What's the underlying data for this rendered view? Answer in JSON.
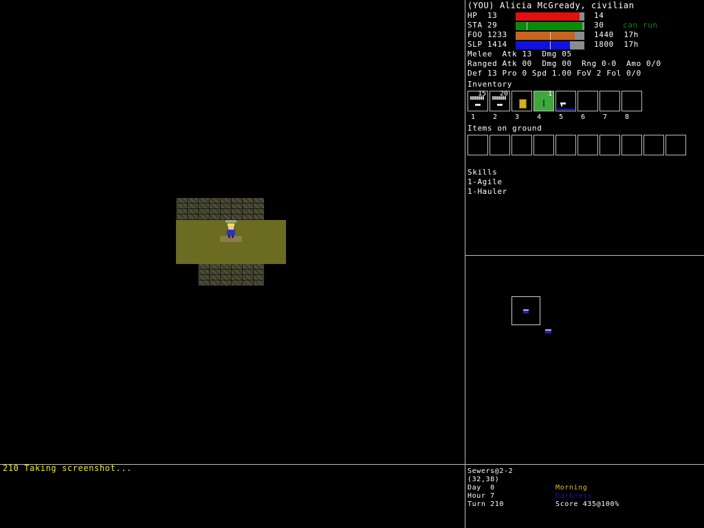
{
  "character": {
    "title": "(YOU) Alicia McGready, civilian"
  },
  "stats": [
    {
      "label": "HP",
      "value": "13",
      "max": "14",
      "extra": "",
      "color": "#e01010",
      "fill": 0.93
    },
    {
      "label": "STA",
      "value": "29",
      "max": "30",
      "extra": "can run",
      "color": "#0a8a0a",
      "fill": 0.97
    },
    {
      "label": "FOO",
      "value": "1233",
      "max": "1440",
      "extra": "17h",
      "color": "#c8641e",
      "fill": 0.86
    },
    {
      "label": "SLP",
      "value": "1414",
      "max": "1800",
      "extra": "17h",
      "color": "#1010e0",
      "fill": 0.79
    }
  ],
  "stat_rows": {
    "hp": "HP  13",
    "sta": "STA 29",
    "foo": "FOO 1233",
    "slp": "SLP 1414",
    "hp_max": "14",
    "sta_max": "30",
    "foo_max": "1440  17h",
    "slp_max": "1800  17h",
    "sta_extra": "can run"
  },
  "combat": {
    "melee": "Melee  Atk 13  Dmg 05",
    "ranged": "Ranged Atk 00  Dmg 00  Rng 0-0  Amo 0/0",
    "defense": "Def 13 Pro 0 Spd 1.00 FoV 2 Fol 0/0"
  },
  "inventory": {
    "heading": "Inventory",
    "slots": [
      {
        "number": "1",
        "qty": "15",
        "item": "ammo-clip"
      },
      {
        "number": "2",
        "qty": "20",
        "item": "ammo-clip"
      },
      {
        "number": "3",
        "qty": "",
        "item": "food-can"
      },
      {
        "number": "4",
        "qty": "1",
        "item": "knife",
        "selected": true
      },
      {
        "number": "5",
        "qty": "",
        "item": "pistol"
      },
      {
        "number": "6",
        "qty": "",
        "item": ""
      },
      {
        "number": "7",
        "qty": "",
        "item": ""
      },
      {
        "number": "8",
        "qty": "",
        "item": ""
      }
    ]
  },
  "ground": {
    "heading": "Items on ground"
  },
  "skills": {
    "heading": "Skills",
    "items": [
      "1-Agile",
      "1-Hauler"
    ]
  },
  "messages": {
    "line1": "210 Taking screenshot..."
  },
  "status": {
    "location": "Sewers@2-2",
    "coords": "(32,38)",
    "day": "Day  0",
    "hour": "Hour 7",
    "turn": "Turn 210",
    "time_of_day": "Morning",
    "light": "Darkness",
    "score": "Score 435@100%"
  },
  "colors": {
    "time_of_day": "#e0c020",
    "light": "#1a1aa0",
    "can_run": "#0a8a0a",
    "message": "#f0f000"
  }
}
